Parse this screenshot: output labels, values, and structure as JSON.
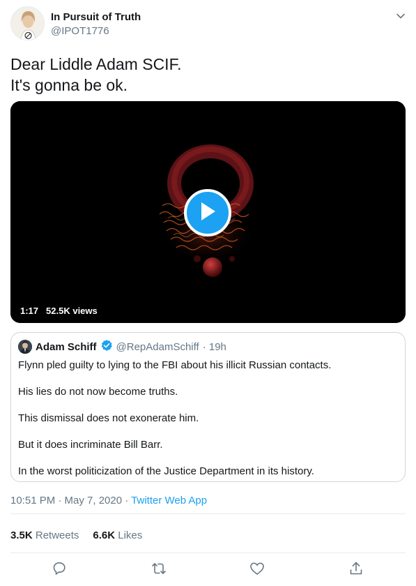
{
  "author": {
    "name": "In Pursuit of Truth",
    "handle": "@IPOT1776"
  },
  "tweet": {
    "lines": [
      "Dear Liddle Adam SCIF.",
      "It's gonna be ok."
    ]
  },
  "video": {
    "duration": "1:17",
    "views": "52.5K views"
  },
  "quoted_tweet": {
    "name": "Adam Schiff",
    "handle": "@RepAdamSchiff",
    "time": "· 19h",
    "paragraphs": [
      "Flynn pled guilty to lying to the FBI about his illicit Russian contacts.",
      "His lies do not now become truths.",
      "This dismissal does not exonerate him.",
      "But it does incriminate Bill Barr.",
      "In the worst politicization of the Justice Department in its history."
    ]
  },
  "meta": {
    "timestamp": "10:51 PM · May 7, 2020 · ",
    "source": "Twitter Web App"
  },
  "stats": {
    "retweets_count": "3.5K",
    "retweets_label": "Retweets",
    "likes_count": "6.6K",
    "likes_label": "Likes"
  },
  "icons": {
    "more": "chevron-down-icon",
    "play": "play-icon",
    "verified": "verified-badge-icon",
    "reply": "reply-icon",
    "retweet": "retweet-icon",
    "like": "heart-icon",
    "share": "share-icon"
  },
  "colors": {
    "accent": "#1da1f2",
    "text": "#14171a",
    "muted": "#657786",
    "border": "#ccd6dd"
  }
}
